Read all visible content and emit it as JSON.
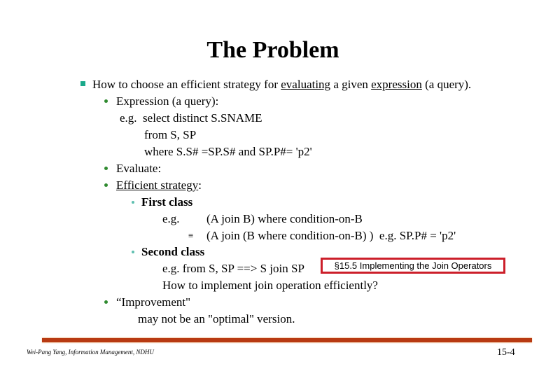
{
  "slide": {
    "title": "The Problem",
    "main_bullet": {
      "pre": "How to choose an efficient strategy for ",
      "u1": "evaluating",
      "mid": " a given ",
      "u2": "expression",
      "post": " (a query)."
    },
    "expression": {
      "label": "Expression (a query):",
      "line1": "e.g.  select distinct S.SNAME",
      "line2": "from S, SP",
      "line3": "where S.S# =SP.S# and SP.P#= 'p2'"
    },
    "evaluate": "Evaluate:",
    "strategy": {
      "label": "Efficient strategy",
      "colon": ":",
      "first_class": {
        "label": "First class",
        "eg": "e.g.",
        "expr1": "(A join B) where condition-on-B",
        "equiv": "≡",
        "expr2": "(A join (B where condition-on-B) )  e.g. SP.P# = 'p2'"
      },
      "second_class": {
        "label": "Second class",
        "line1": "e.g. from S, SP ==> S join SP",
        "line2": "How to implement join operation efficiently?",
        "callout": "§15.5 Implementing the Join Operators"
      }
    },
    "improvement": {
      "label": "“Improvement\"",
      "line": "may not be an \"optimal\" version."
    },
    "footer": {
      "author": "Wei-Pang Yang, Information Management, NDHU",
      "page": "15-4"
    },
    "colors": {
      "rule": "#b83a12",
      "callout_border": "#cc1f2a",
      "square_bullet": "#1aa98a",
      "dot_bullet": "#2f8a2f"
    }
  }
}
